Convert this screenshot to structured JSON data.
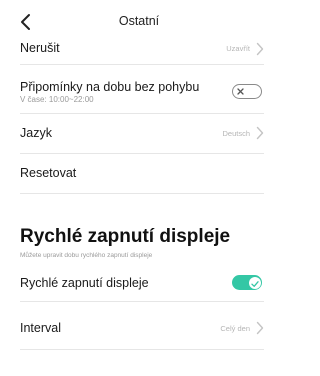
{
  "header": {
    "title": "Ostatní",
    "back_icon": "back-arrow-icon"
  },
  "rows": {
    "nerusit": {
      "label": "Nerušit",
      "value": "Uzavřít"
    },
    "pripominky": {
      "label": "Připomínky na dobu bez pohybu",
      "sub": "V čase: 10:00~22:00",
      "toggle": "off"
    },
    "jazyk": {
      "label": "Jazyk",
      "value": "Deutsch"
    },
    "resetovat": {
      "label": "Resetovat"
    }
  },
  "section": {
    "title": "Rychlé zapnutí displeje",
    "description": "Můžete upravit dobu rychlého zapnutí displeje"
  },
  "section_rows": {
    "rychle": {
      "label": "Rychlé zapnutí displeje",
      "toggle": "on"
    },
    "interval": {
      "label": "Interval",
      "value": "Celý den"
    }
  },
  "colors": {
    "accent": "#34c7a5",
    "divider": "#e6e6e6",
    "muted_text": "#9a9a9a"
  }
}
